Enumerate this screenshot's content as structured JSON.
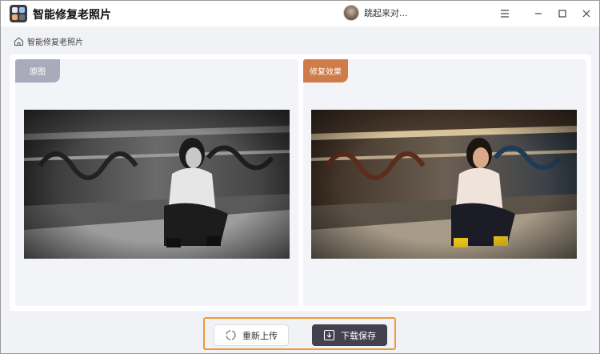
{
  "titlebar": {
    "app_title": "智能修复老照片",
    "user_name": "跳起来对...",
    "menu_icon": "menu-icon",
    "minimize_icon": "minimize-icon",
    "maximize_icon": "maximize-icon",
    "close_icon": "close-icon"
  },
  "breadcrumb": {
    "icon": "home-icon",
    "label": "智能修复老照片"
  },
  "panes": {
    "original_label": "原图",
    "restored_label": "修复效果"
  },
  "actions": {
    "reupload_label": "重新上传",
    "download_label": "下载保存"
  },
  "colors": {
    "accent_orange": "#d07b4a",
    "frame_orange": "#ee9a3a",
    "dark_button": "#434150",
    "tag_gray": "#a9abbb"
  }
}
